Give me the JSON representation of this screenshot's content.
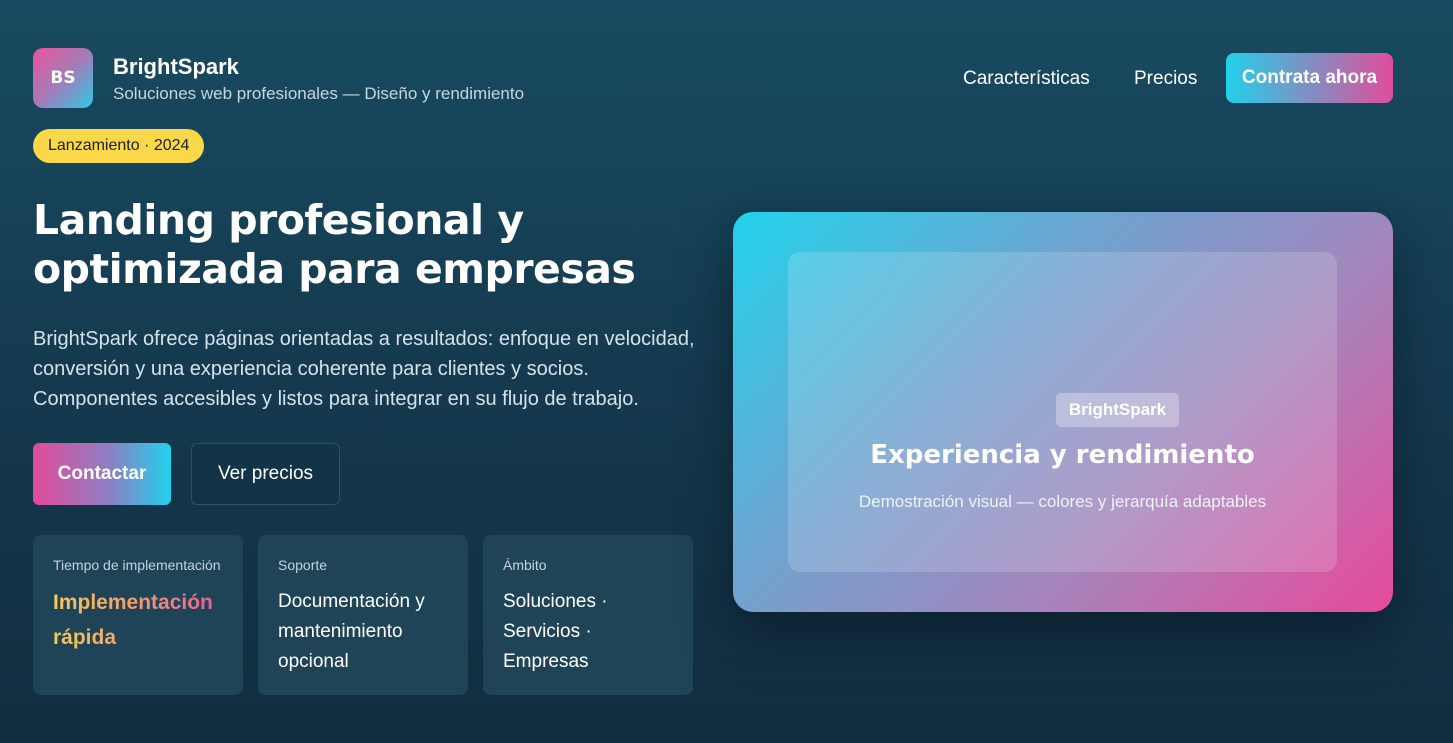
{
  "brand": {
    "logo_text": "BS",
    "name": "BrightSpark",
    "tagline": "Soluciones web profesionales — Diseño y rendimiento"
  },
  "nav": {
    "features": "Características",
    "pricing": "Precios",
    "cta": "Contrata ahora"
  },
  "badge": "Lanzamiento · 2024",
  "hero": {
    "title": "Landing profesional y optimizada para empresas",
    "description": "BrightSpark ofrece páginas orientadas a resultados: enfoque en velocidad, conversión y una experiencia coherente para clientes y socios. Componentes accesibles y listos para integrar en su flujo de trabajo.",
    "primary_button": "Contactar",
    "secondary_button": "Ver precios"
  },
  "stats": [
    {
      "label": "Tiempo de implementación",
      "value": "Implementación rápida"
    },
    {
      "label": "Soporte",
      "value": "Documentación y mantenimiento opcional"
    },
    {
      "label": "Ámbito",
      "value": "Soluciones · Servicios · Empresas"
    }
  ],
  "showcase": {
    "tag": "BrightSpark",
    "title": "Experiencia y rendimiento",
    "subtitle": "Demostración visual — colores y jerarquía adaptables"
  },
  "colors": {
    "background": "#163f54",
    "accent_cyan": "#22d3ec",
    "accent_pink": "#e84a9b",
    "badge_yellow": "#fad84a",
    "card": "#1f4457"
  }
}
